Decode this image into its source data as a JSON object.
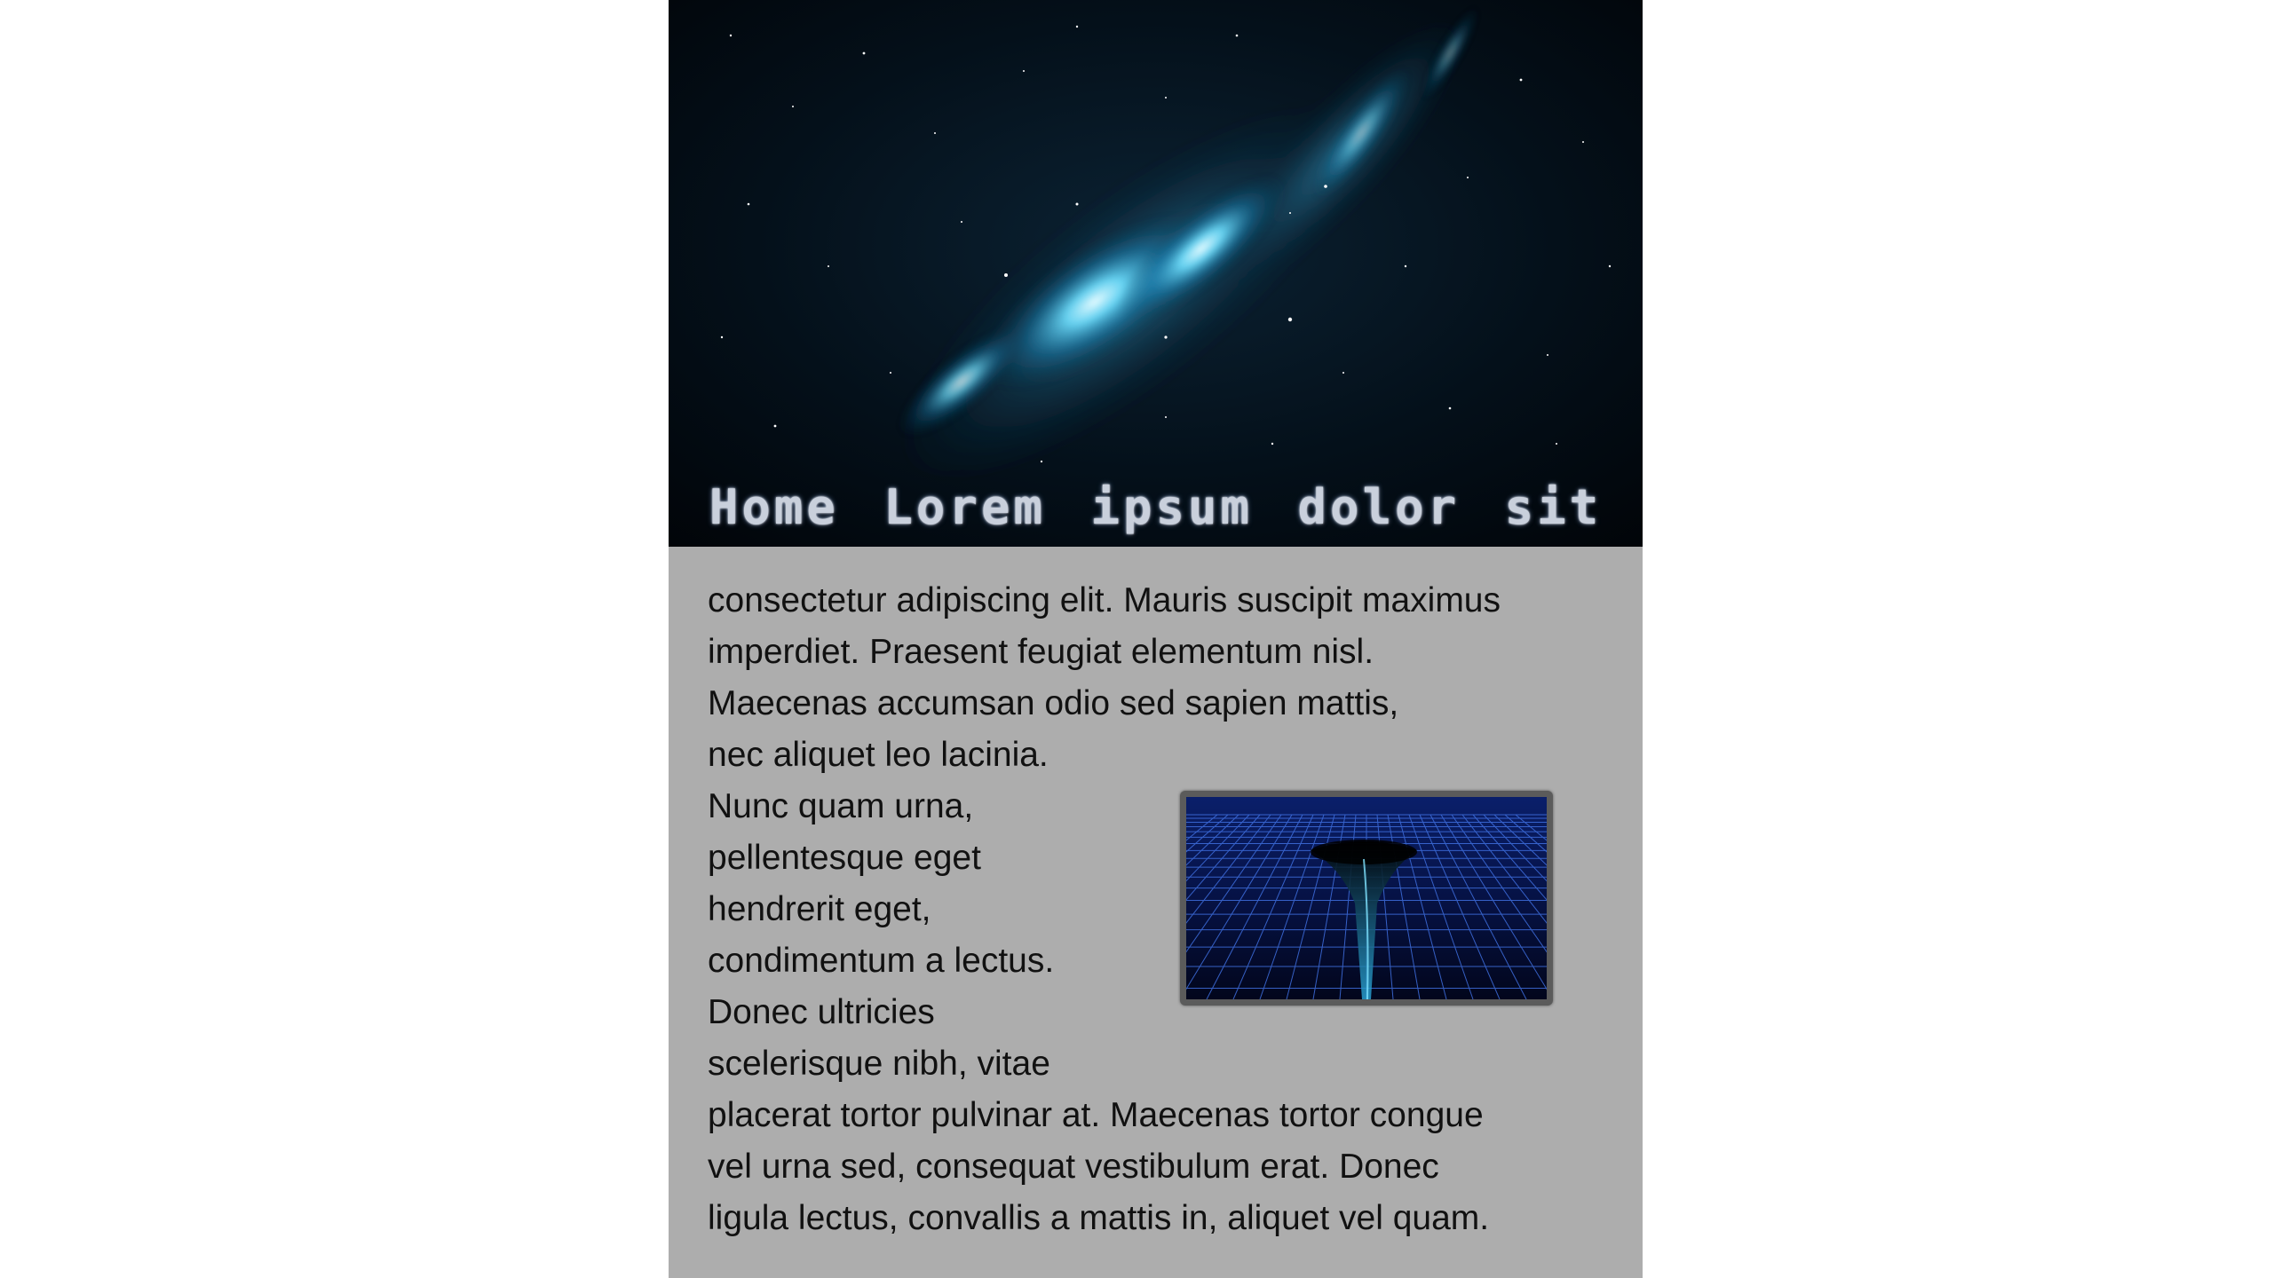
{
  "hero": {
    "title": "Home Lorem ipsum dolor sit",
    "image": "space-nebula-image"
  },
  "article": {
    "lines": [
      "consectetur adipiscing elit. Mauris suscipit maximus",
      "imperdiet. Praesent feugiat elementum nisl.",
      "Maecenas accumsan odio sed sapien mattis,",
      "nec aliquet leo lacinia.",
      "Nunc quam urna,",
      "pellentesque eget",
      "hendrerit eget,",
      "condimentum a lectus.",
      "Donec ultricies",
      "scelerisque nibh, vitae",
      "placerat tortor pulvinar at. Maecenas tortor congue",
      "vel urna sed, consequat vestibulum erat. Donec",
      "ligula lectus, convallis a mattis in, aliquet vel quam."
    ]
  },
  "figure": {
    "image": "spacetime-grid-image"
  },
  "colors": {
    "page_background": "#adadad",
    "body_background": "#ffffff",
    "text": "#111111",
    "figure_frame": "#5b5b5b",
    "grid_line": "#3f6fe0"
  }
}
